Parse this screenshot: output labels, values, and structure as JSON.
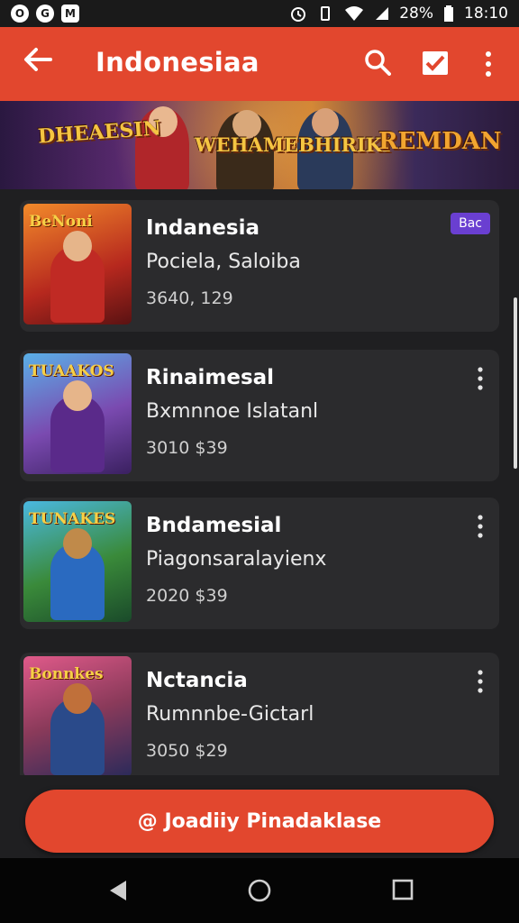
{
  "status_bar": {
    "notif_icons": [
      "O",
      "G",
      "M"
    ],
    "battery_text": "28%",
    "time": "18:10"
  },
  "app_bar": {
    "title": "Indonesiaa"
  },
  "banner": {
    "logo_left": "DHEAESIN",
    "logo_center": "WEHAMEBHIRIKI",
    "logo_right": "REMDAN"
  },
  "items": [
    {
      "title": "Indanesia",
      "subtitle": "Pociela, Saloiba",
      "price": "3640, 129",
      "thumb_logo": "BeNoni",
      "badge": "Bac"
    },
    {
      "title": "Rinaimesal",
      "subtitle": "Bxmnnoe Islatanl",
      "price": "3010 $39",
      "thumb_logo": "TUAAKOS"
    },
    {
      "title": "Bndamesial",
      "subtitle": "Piagonsaralayienx",
      "price": "2020 $39",
      "thumb_logo": "TUNAKES"
    },
    {
      "title": "Nctancia",
      "subtitle": "Rumnnbe-Gictarl",
      "price": "3050 $29",
      "thumb_logo": "Bonnkes"
    }
  ],
  "cta": {
    "label": "@ Joadiiy Pinadaklase"
  },
  "colors": {
    "accent": "#e2472e",
    "card": "#2b2b2d",
    "badge": "#6a3fd1"
  }
}
